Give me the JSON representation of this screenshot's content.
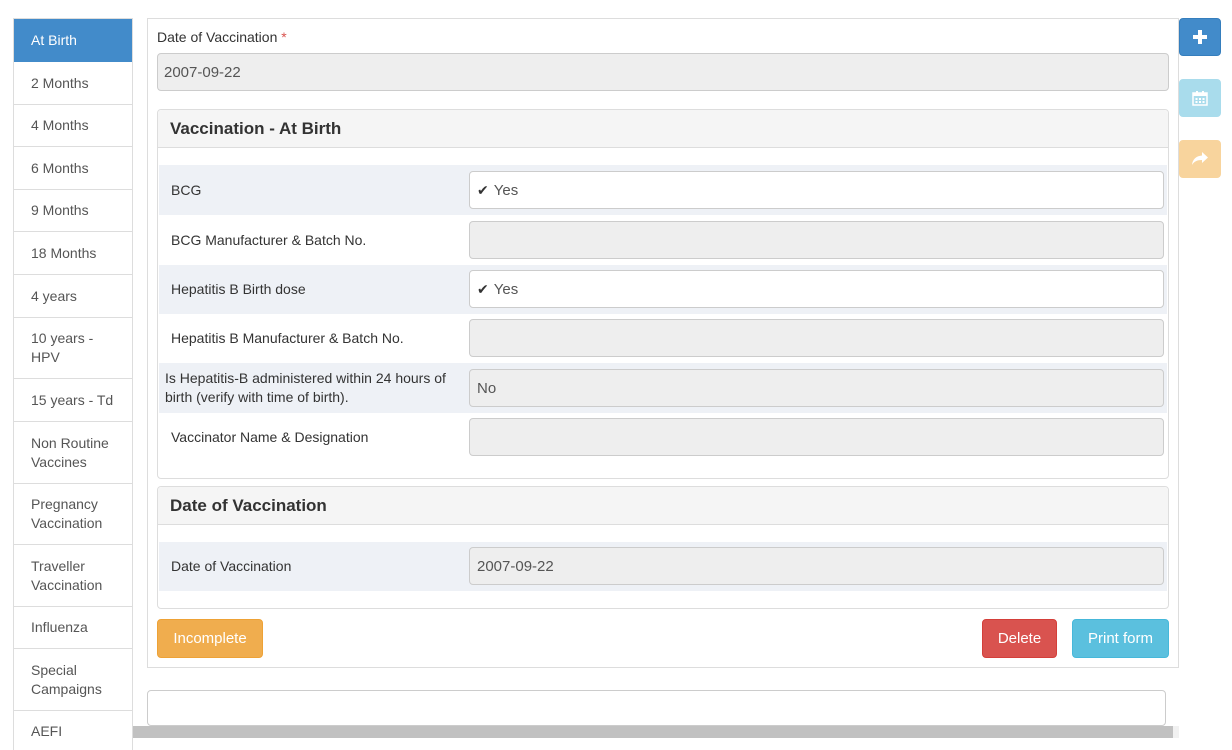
{
  "sidebar": {
    "items": [
      {
        "label": "At Birth",
        "active": true
      },
      {
        "label": "2 Months"
      },
      {
        "label": "4 Months"
      },
      {
        "label": "6 Months"
      },
      {
        "label": "9 Months"
      },
      {
        "label": "18 Months"
      },
      {
        "label": "4 years"
      },
      {
        "label": "10 years - HPV"
      },
      {
        "label": "15 years - Td"
      },
      {
        "label": "Non Routine Vaccines"
      },
      {
        "label": "Pregnancy Vaccination"
      },
      {
        "label": "Traveller Vaccination"
      },
      {
        "label": "Influenza"
      },
      {
        "label": "Special Campaigns"
      },
      {
        "label": "AEFI"
      }
    ]
  },
  "form": {
    "date_label": "Date of Vaccination",
    "required_marker": "*",
    "date_value": "2007-09-22",
    "vaccination_panel": {
      "title": "Vaccination - At Birth",
      "rows": [
        {
          "label": "BCG",
          "value": "Yes",
          "checked": true
        },
        {
          "label": "BCG Manufacturer & Batch No.",
          "value": ""
        },
        {
          "label": "Hepatitis B Birth dose",
          "value": "Yes",
          "checked": true
        },
        {
          "label": "Hepatitis B Manufacturer & Batch No.",
          "value": ""
        },
        {
          "label": "Is Hepatitis-B administered within 24 hours of birth (verify with time of birth).",
          "value": "No"
        },
        {
          "label": "Vaccinator Name & Designation",
          "value": ""
        }
      ]
    },
    "date_panel": {
      "title": "Date of Vaccination",
      "row_label": "Date of Vaccination",
      "row_value": "2007-09-22"
    }
  },
  "buttons": {
    "incomplete": "Incomplete",
    "delete": "Delete",
    "print": "Print form"
  },
  "toolbar": {
    "add_icon": "plus-icon",
    "calendar_icon": "calendar-icon",
    "share_icon": "share-icon"
  },
  "colors": {
    "primary": "#428bca",
    "warning": "#f0ad4e",
    "danger": "#d9534f",
    "info": "#5bc0de"
  }
}
